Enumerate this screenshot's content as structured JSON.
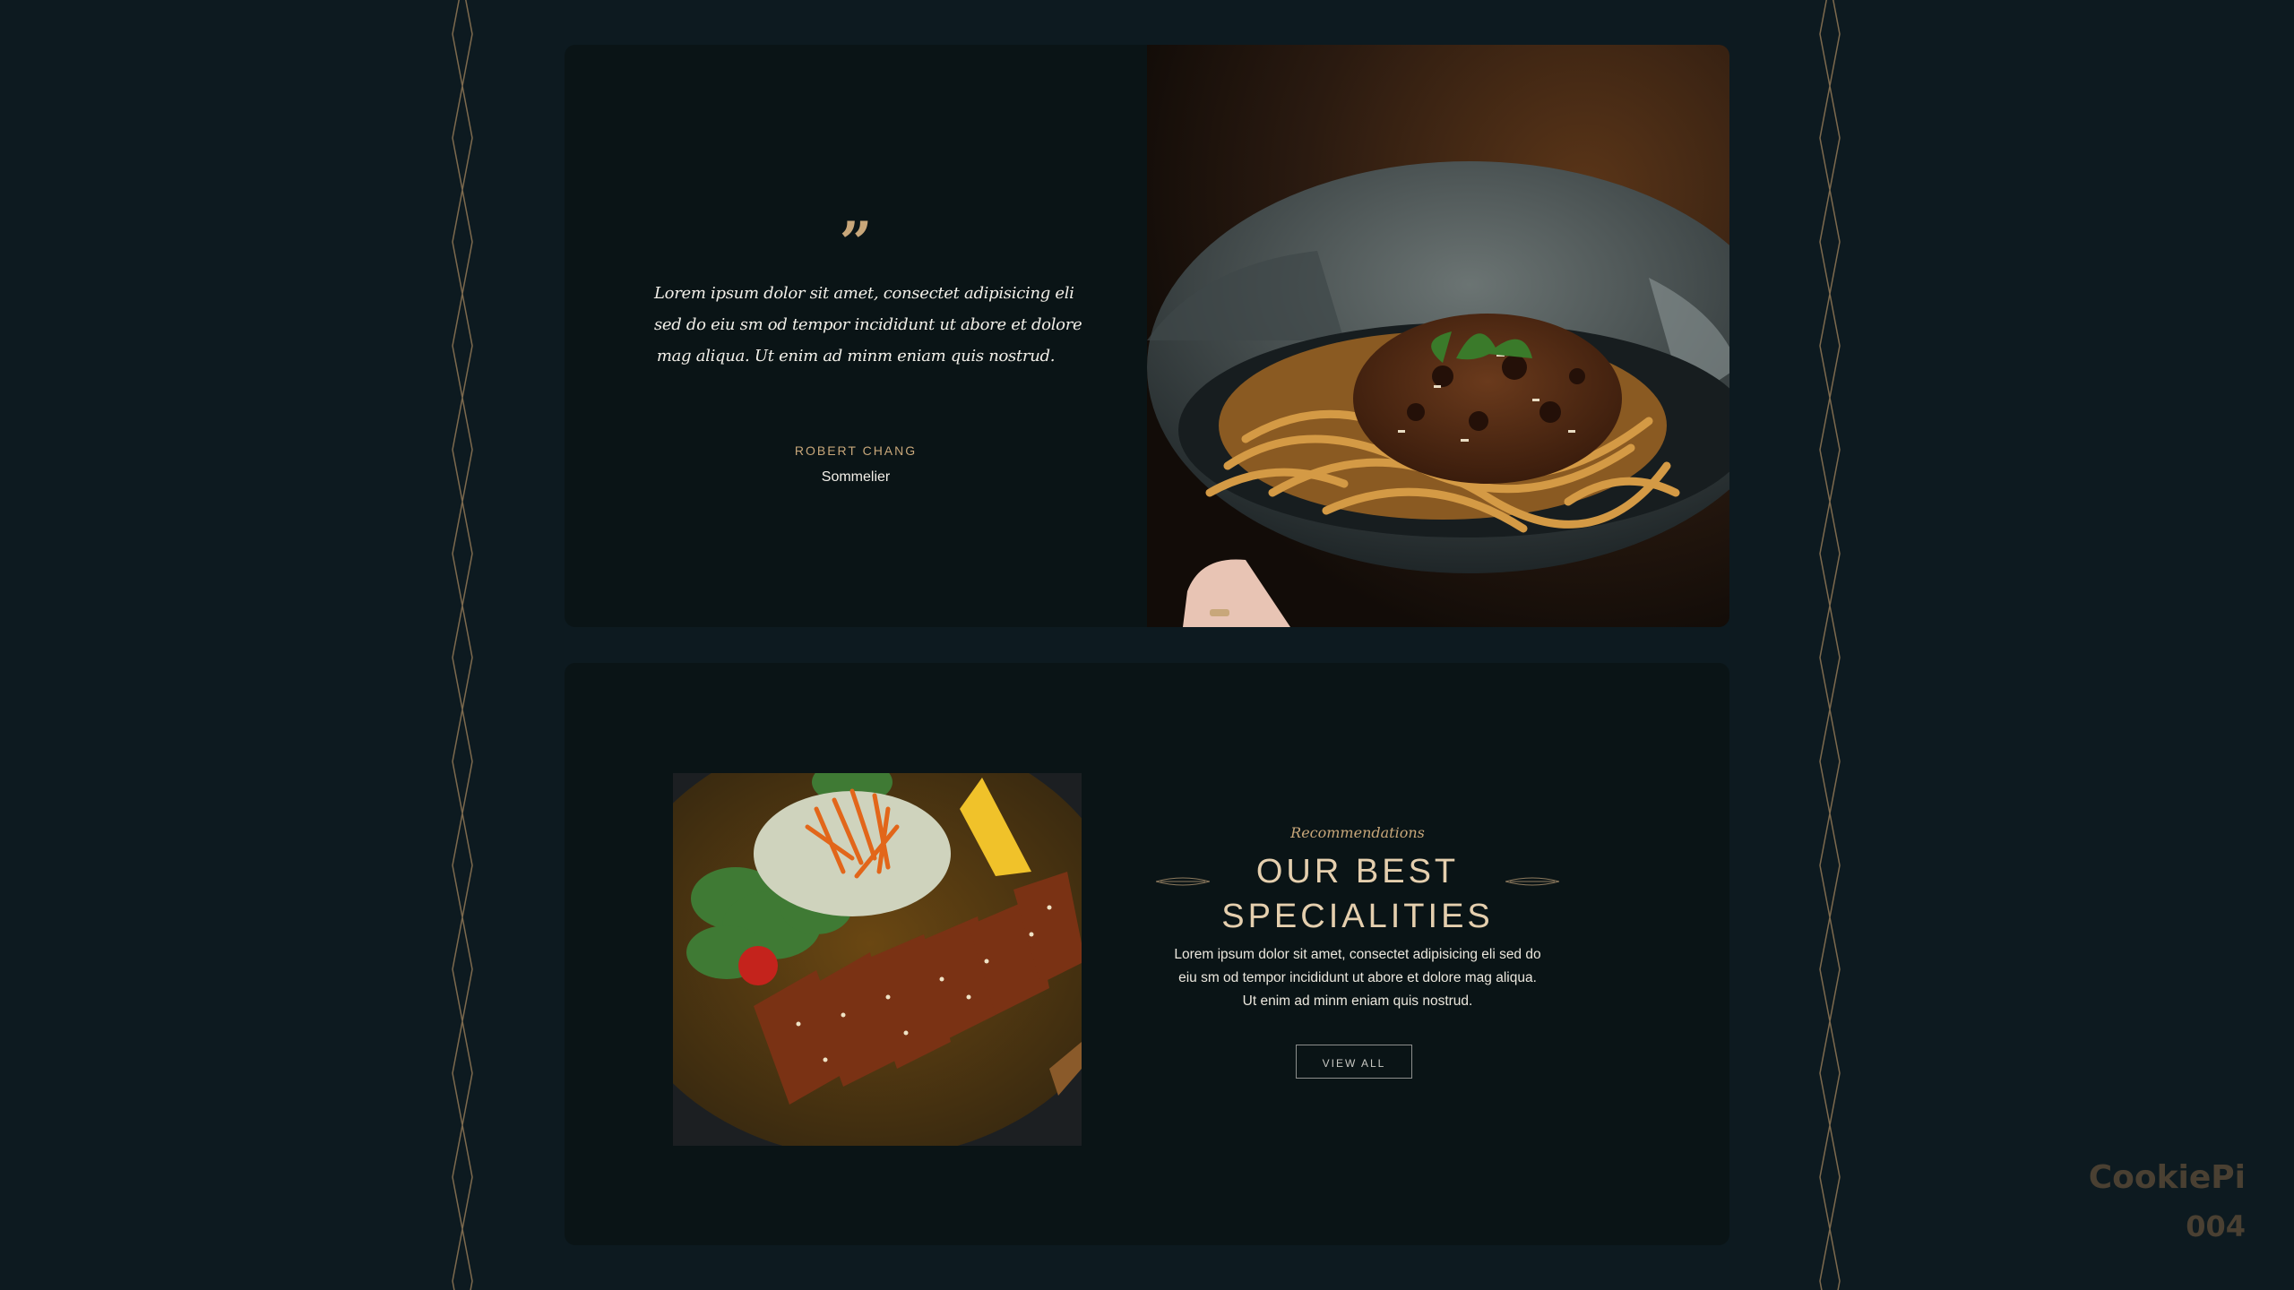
{
  "testimonial": {
    "quote_mark": "”",
    "quote_lines": [
      "Lorem ipsum dolor sit amet, consectet adipisicing eli",
      "sed do eiu sm od tempor incididunt ut abore et dolore",
      "mag aliqua. Ut enim ad minm eniam quis nostrud."
    ],
    "author_name": "ROBERT CHANG",
    "author_role": "Sommelier"
  },
  "specialities": {
    "kicker": "Recommendations",
    "title_lines": [
      "OUR BEST",
      "SPECIALITIES"
    ],
    "description_lines": [
      "Lorem ipsum dolor sit amet, consectet adipisicing eli sed do",
      "eiu sm od tempor incididunt ut abore et dolore mag aliqua.",
      "Ut enim ad minm eniam quis nostrud."
    ],
    "button_label": "VIEW ALL"
  },
  "watermark": {
    "brand": "CookiePi",
    "number": "004"
  },
  "colors": {
    "background": "#0d1a20",
    "card": "#0a1416",
    "accent_gold": "#c8a77a",
    "title_gold": "#e5cfae"
  }
}
